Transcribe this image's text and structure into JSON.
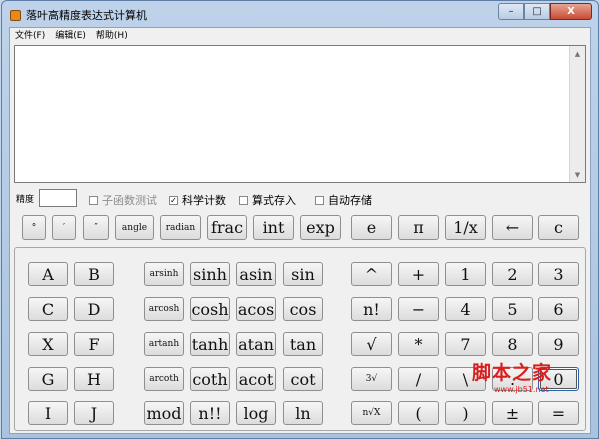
{
  "window": {
    "title": "落叶高精度表达式计算机",
    "caption_buttons": {
      "minimize": "–",
      "maximize": "□",
      "close": "X"
    }
  },
  "menu": [
    "文件(F)",
    "编辑(E)",
    "帮助(H)"
  ],
  "display": {
    "text": ""
  },
  "options": {
    "precision_label": "精度",
    "precision_value": "",
    "checkboxes": [
      {
        "label": "子函数测试",
        "checked": false,
        "enabled": false
      },
      {
        "label": "科学计数",
        "checked": true,
        "enabled": true
      },
      {
        "label": "算式存入",
        "checked": false,
        "enabled": true
      },
      {
        "label": "自动存储",
        "checked": false,
        "enabled": true
      }
    ]
  },
  "top_row": [
    "°",
    "′",
    "″",
    "angle",
    "radian",
    "frac",
    "int",
    "exp",
    "e",
    "π",
    "1/x",
    "←",
    "c"
  ],
  "keypad": {
    "letters": [
      [
        "A",
        "B"
      ],
      [
        "C",
        "D"
      ],
      [
        "X",
        "F"
      ],
      [
        "G",
        "H"
      ],
      [
        "I",
        "J"
      ]
    ],
    "functions": [
      [
        "arsinh",
        "sinh",
        "asin",
        "sin"
      ],
      [
        "arcosh",
        "cosh",
        "acos",
        "cos"
      ],
      [
        "artanh",
        "tanh",
        "atan",
        "tan"
      ],
      [
        "arcoth",
        "coth",
        "acot",
        "cot"
      ],
      [
        "mod",
        "n!!",
        "log",
        "ln"
      ]
    ],
    "operators": [
      [
        "^",
        "+",
        "1",
        "2",
        "3"
      ],
      [
        "n!",
        "−",
        "4",
        "5",
        "6"
      ],
      [
        "√",
        "*",
        "7",
        "8",
        "9"
      ],
      [
        "3√",
        "/",
        "\\",
        ".",
        "0"
      ],
      [
        "n√X",
        "(",
        ")",
        "±",
        "="
      ]
    ]
  },
  "watermark": {
    "logo": "脚本之家",
    "url": "www.jb51.net"
  },
  "icon": {
    "check": "✓",
    "scroll_up": "▲",
    "scroll_down": "▼"
  }
}
